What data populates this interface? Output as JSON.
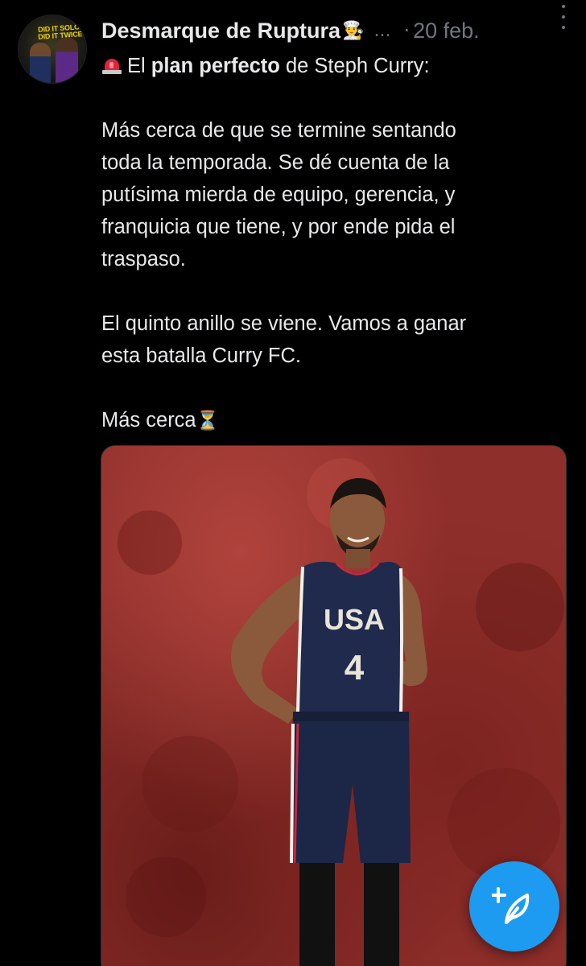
{
  "author": {
    "name": "Desmarque de Ruptura",
    "name_emoji": "👨‍🍳",
    "truncation": "...",
    "separator": "·",
    "date": "20 feb.",
    "avatar_text_line1": "DID IT SOLO,",
    "avatar_text_line2": "DID IT TWICE"
  },
  "tweet": {
    "intro_pre": "El ",
    "intro_bold": "plan perfecto",
    "intro_post": " de Steph Curry:",
    "p1_lines": [
      "Más cerca de que se termine sentando",
      "toda la temporada. Se dé cuenta de la",
      "putísima mierda de equipo, gerencia, y",
      "franquicia que tiene, y por ende pida el",
      "traspaso."
    ],
    "p2_lines": [
      "El quinto anillo se viene. Vamos a ganar",
      "esta batalla Curry FC."
    ],
    "p3_text": "Más cerca",
    "p3_emoji": "⏳"
  },
  "media": {
    "jersey_text": "USA",
    "jersey_number": "4"
  },
  "colors": {
    "background": "#000000",
    "text": "#e7e9ea",
    "muted": "#71767b",
    "accent": "#1d9bf0",
    "jersey": "#1f2a4d"
  },
  "icons": {
    "menu": "more-vertical-icon",
    "fab": "compose-post-icon",
    "siren": "siren-icon"
  }
}
